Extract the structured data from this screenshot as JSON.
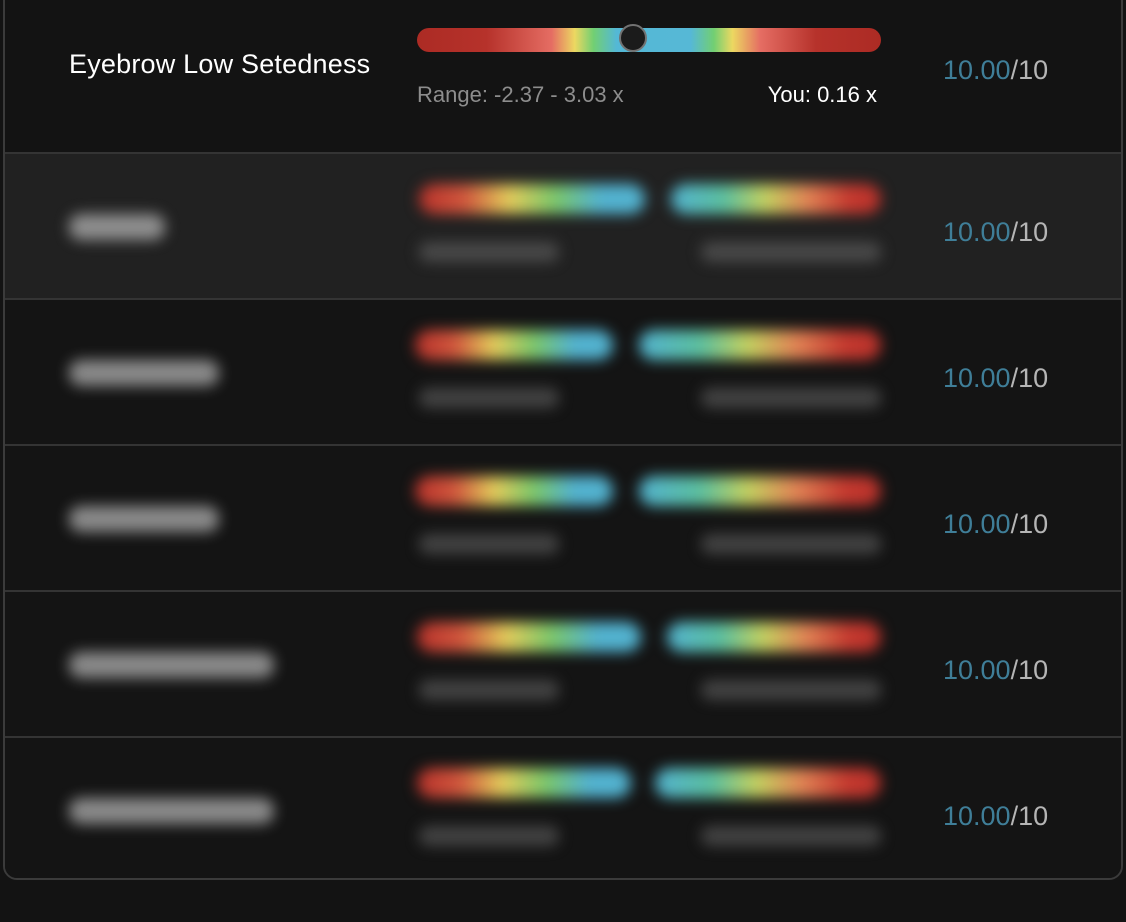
{
  "rows": [
    {
      "label": "Eyebrow Low Setedness",
      "range_text": "Range: -2.37 - 3.03 x",
      "you_text": "You: 0.16 x",
      "slider_position": 0.466,
      "score_value": "10.00",
      "score_max": "/10"
    },
    {
      "score_value": "10.00",
      "score_max": "/10"
    },
    {
      "score_value": "10.00",
      "score_max": "/10"
    },
    {
      "score_value": "10.00",
      "score_max": "/10"
    },
    {
      "score_value": "10.00",
      "score_max": "/10"
    },
    {
      "score_value": "10.00",
      "score_max": "/10"
    }
  ],
  "colors": {
    "score_accent": "#3f7e98",
    "background": "#131313",
    "highlight_row": "#212121"
  }
}
